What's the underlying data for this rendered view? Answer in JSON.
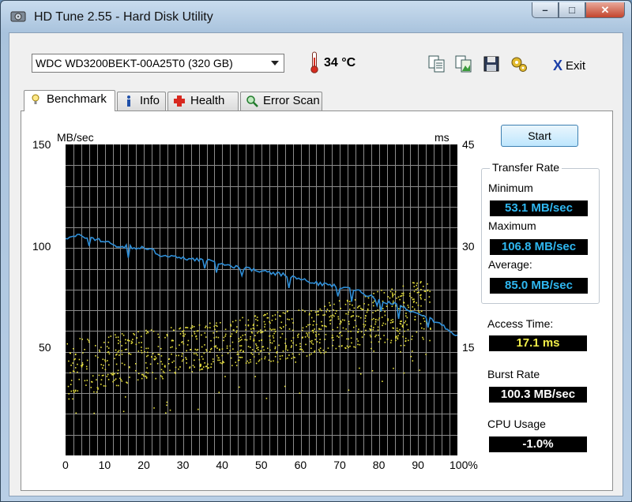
{
  "window": {
    "title": "HD Tune 2.55 - Hard Disk Utility",
    "min_glyph": "–",
    "max_glyph": "□",
    "close_glyph": "✕"
  },
  "toolbar": {
    "drive": "WDC WD3200BEKT-00A25T0 (320 GB)",
    "temperature": "34 °C",
    "tools": [
      "copy-text-icon",
      "copy-image-icon",
      "save-icon",
      "options-icon"
    ],
    "exit_glyph": "X",
    "exit_label": "Exit"
  },
  "tabs": [
    {
      "label": "Benchmark",
      "icon": "benchmark-icon",
      "active": true
    },
    {
      "label": "Info",
      "icon": "info-icon",
      "active": false
    },
    {
      "label": "Health",
      "icon": "health-icon",
      "active": false
    },
    {
      "label": "Error Scan",
      "icon": "error-scan-icon",
      "active": false
    }
  ],
  "chart_data": {
    "type": "line",
    "left_unit": "MB/sec",
    "right_unit": "ms",
    "ylim_left": [
      0,
      150
    ],
    "ylim_right": [
      0,
      45
    ],
    "xlim": [
      0,
      100
    ],
    "y_ticks_left": [
      "150",
      "100",
      "50"
    ],
    "y_ticks_right": [
      "45",
      "30",
      "15"
    ],
    "x_ticks": [
      "0",
      "10",
      "20",
      "30",
      "40",
      "50",
      "60",
      "70",
      "80",
      "90",
      "100%"
    ],
    "grid": true,
    "series": [
      {
        "name": "Transfer Rate",
        "color": "#2f8fd8",
        "x": [
          0,
          2,
          4,
          6,
          8,
          10,
          12,
          14,
          16,
          18,
          20,
          22,
          24,
          26,
          28,
          30,
          32,
          34,
          36,
          38,
          40,
          42,
          44,
          46,
          48,
          50,
          52,
          54,
          56,
          58,
          60,
          62,
          64,
          66,
          68,
          70,
          72,
          74,
          76,
          78,
          80,
          82,
          84,
          86,
          88,
          90,
          92,
          94,
          96,
          98,
          100
        ],
        "y": [
          105,
          105.5,
          106,
          105,
          104,
          103.5,
          102,
          100,
          101,
          100,
          100,
          99,
          97,
          96,
          95.5,
          95,
          95,
          94.5,
          94,
          93,
          92,
          91.5,
          91,
          90,
          89.5,
          89,
          88,
          87.5,
          87,
          86,
          85,
          84,
          83,
          82.5,
          82,
          81,
          80.5,
          80,
          78.5,
          76.5,
          75,
          74,
          73,
          71.5,
          70,
          69,
          67.5,
          65,
          63,
          60,
          58
        ]
      },
      {
        "name": "Access Time",
        "type": "scatter",
        "color": "#e9e23b",
        "point_count": 1000,
        "band_low_ms": [
          8,
          9.5,
          11,
          12,
          12.8,
          13.5,
          14.3,
          15.3,
          16.1,
          16.8,
          17.5
        ],
        "band_high_ms": [
          17,
          17.6,
          18.2,
          18.8,
          19.6,
          20.5,
          21.5,
          22.6,
          24,
          25.5,
          27
        ]
      }
    ]
  },
  "controls": {
    "start_label": "Start"
  },
  "stats": {
    "transfer_title": "Transfer Rate",
    "minimum_label": "Minimum",
    "minimum": "53.1 MB/sec",
    "maximum_label": "Maximum",
    "maximum": "106.8 MB/sec",
    "average_label": "Average:",
    "average": "85.0 MB/sec",
    "access_label": "Access Time:",
    "access": "17.1 ms",
    "burst_label": "Burst Rate",
    "burst": "100.3 MB/sec",
    "cpu_label": "CPU Usage",
    "cpu": "-1.0%"
  }
}
